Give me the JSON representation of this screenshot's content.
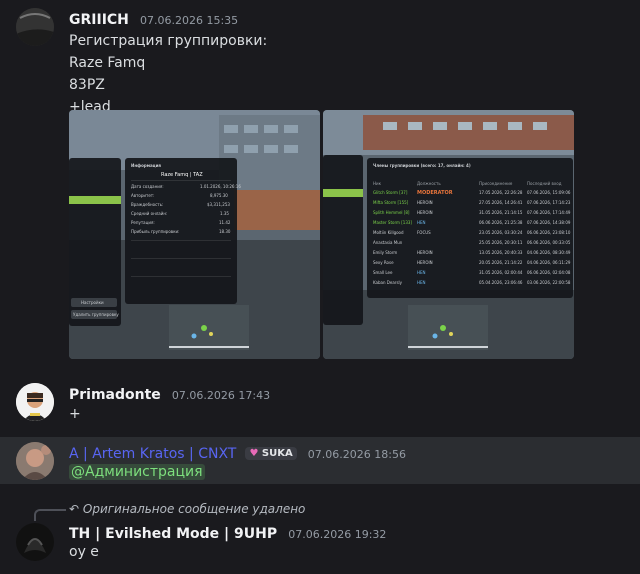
{
  "messages": [
    {
      "author": "GRIIICH",
      "time": "07.06.2026 15:35",
      "lines": [
        "Регистрация группировки:",
        "Raze Famq",
        "83PZ",
        "+lead"
      ],
      "screenshots": {
        "left": {
          "panel_title": "Raze Famq | TAZ",
          "panel_heading": "Информация",
          "rows": [
            [
              "Дата создания:",
              "1.01.2026, 10:26:16"
            ],
            [
              "Авторитет:",
              "8,975.30"
            ],
            [
              "Враждебность:",
              "$3,311,253"
            ],
            [
              "Средний онлайн:",
              "1.35"
            ],
            [
              "Репутация:",
              "11.42"
            ],
            [
              "Прибыль группировки:",
              "18.30"
            ]
          ],
          "side_buttons": [
            "Настройки",
            "Удалить группировку"
          ]
        },
        "right": {
          "panel_title": "Члены группировки (всего: 17, онлайн: 4)",
          "columns": [
            "Ник",
            "Должность",
            "Присоединение",
            "Последний вход"
          ],
          "members": [
            [
              "Glitch Storm [37]",
              "MODERATOR",
              "17.05.2026, 22:26:28",
              "07.06.2026, 15:09:06"
            ],
            [
              "Mifta Storm [155]",
              "HEROIN",
              "27.05.2026, 14:26:41",
              "07.06.2026, 17:14:23"
            ],
            [
              "Splith Hemmel [8]",
              "HEROIN",
              "31.05.2026, 21:14:15",
              "07.06.2026, 17:14:49"
            ],
            [
              "Master Storm [133]",
              "HEN",
              "06.06.2026, 21:25:38",
              "07.06.2026, 14:38:09"
            ],
            [
              "Moltiin Killgood",
              "FOCUS",
              "23.05.2026, 03:30:24",
              "06.06.2026, 23:08:10"
            ],
            [
              "Anastasia Mun",
              "",
              "25.05.2026, 20:30:11",
              "06.06.2026, 00:33:05"
            ],
            [
              "Emily Storm",
              "HEROIN",
              "13.05.2026, 20:40:33",
              "04.06.2026, 08:30:49"
            ],
            [
              "Sexy Rose",
              "HEROIN",
              "20.05.2026, 21:14:22",
              "04.06.2026, 06:11:29"
            ],
            [
              "Small Lee",
              "HEN",
              "31.05.2026, 02:00:44",
              "06.06.2026, 02:04:08"
            ],
            [
              "Kaban Dearsly",
              "HEN",
              "05.04.2026, 23:06:46",
              "03.06.2026, 22:00:58"
            ]
          ]
        }
      }
    },
    {
      "author": "Primadonte",
      "time": "07.06.2026 17:43",
      "text": "+"
    },
    {
      "author": "A | Artem Kratos | CNXT",
      "tag": "SUKA",
      "time": "07.06.2026 18:56",
      "mention": "@Администрация"
    },
    {
      "reply_text": "Оригинальное сообщение удалено",
      "author": "TH | Evilshed Mode | 9UHP",
      "time": "07.06.2026 19:32",
      "text": "оу е"
    }
  ],
  "colors": {
    "background": "#1a1a1e",
    "author_blue": "#5865f2",
    "mention_green": "#7ddf7d",
    "tag_pink": "#e86ab8"
  },
  "icons": [
    "reply-arrow-icon",
    "heart-tag-icon"
  ]
}
